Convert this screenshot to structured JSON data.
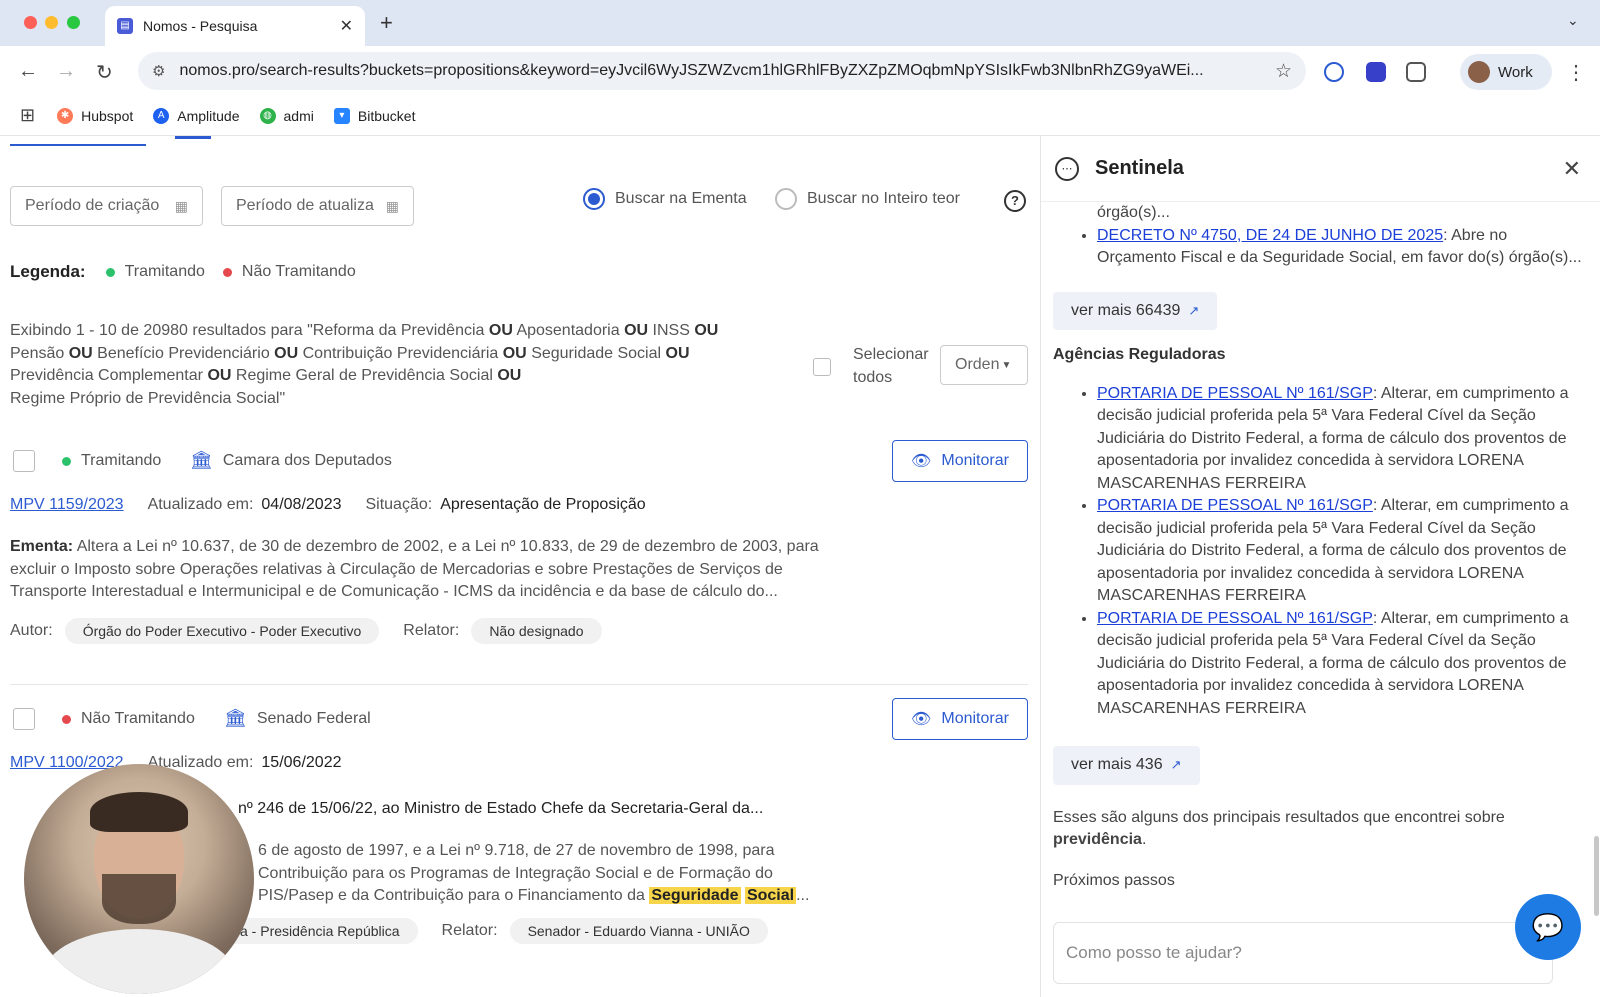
{
  "browser": {
    "tab_title": "Nomos - Pesquisa",
    "url": "nomos.pro/search-results?buckets=propositions&keyword=eyJvcil6WyJSZWZvcm1hlGRhlFByZXZpZMOqbmNpYSIsIkFwb3NlbnRhZG9yaWEi...",
    "profile_label": "Work",
    "bookmarks": [
      "Hubspot",
      "Amplitude",
      "admi",
      "Bitbucket"
    ]
  },
  "filters": {
    "created_placeholder": "Período de criação",
    "updated_placeholder": "Período de atualiza",
    "radio_ementa": "Buscar na Ementa",
    "radio_inteiro": "Buscar no Inteiro teor"
  },
  "legend": {
    "title": "Legenda:",
    "tramitando": "Tramitando",
    "nao_tramitando": "Não Tramitando"
  },
  "results": {
    "line1_pre": "Exibindo 1 - 10 de 20980 resultados para  \"Reforma da Previdência",
    "or": "OU",
    "t_aposentadoria": "Aposentadoria",
    "t_inss": "INSS",
    "t_pensao": "Pensão",
    "t_beneficio": "Benefício Previdenciário",
    "t_contribuicao": "Contribuição Previdenciária",
    "t_seguridade": "Seguridade Social",
    "t_complementar": "Previdência Complementar",
    "t_regime_geral": "Regime Geral de Previdência Social",
    "t_regime_proprio": "Regime Próprio de Previdência Social\"",
    "select_all": "Selecionar todos",
    "order": "Orden"
  },
  "cards": [
    {
      "status": "Tramitando",
      "house": "Camara dos Deputados",
      "monitor": "Monitorar",
      "id": "MPV 1159/2023",
      "updated_label": "Atualizado em:",
      "updated": "04/08/2023",
      "situation_label": "Situação:",
      "situation": "Apresentação de Proposição",
      "ementa_label": "Ementa:",
      "ementa": "Altera a Lei nº 10.637, de 30 de dezembro de 2002, e a Lei nº 10.833, de 29 de dezembro de 2003, para excluir o Imposto sobre Operações relativas à Circulação de Mercadorias e sobre Prestações de Serviços de Transporte Interestadual e Intermunicipal e de Comunicação - ICMS da incidência e da base de cálculo do...",
      "autor_label": "Autor:",
      "autor": "Órgão do Poder Executivo - Poder Executivo",
      "relator_label": "Relator:",
      "relator": "Não designado"
    },
    {
      "status": "Não Tramitando",
      "house": "Senado Federal",
      "monitor": "Monitorar",
      "id": "MPV 1100/2022",
      "updated_label": "Atualizado em:",
      "updated": "15/06/2022",
      "situation_partial": "nº 246 de 15/06/22, ao Ministro de Estado Chefe da Secretaria-Geral da...",
      "ementa_l1": "6 de agosto de 1997, e a Lei nº 9.718, de 27 de novembro de 1998, para",
      "ementa_l2": "Contribuição para os Programas de Integração Social e de Formação do",
      "ementa_l3": "PIS/Pasep e da Contribuição para o Financiamento da",
      "hl1": "Seguridade",
      "hl2": "Social",
      "ellipsis": "...",
      "autor_partial": "a - Presidência República",
      "relator_label": "Relator:",
      "relator": "Senador - Eduardo Vianna - UNIÃO"
    }
  ],
  "panel": {
    "title": "Sentinela",
    "top_fragment": "órgão(s)...",
    "decreto_link": "DECRETO Nº 4750, DE 24 DE JUNHO DE 2025",
    "decreto_text": ": Abre no Orçamento Fiscal e da Seguridade Social, em favor do(s) órgão(s)...",
    "ver_mais_1": "ver mais 66439",
    "agencias_title": "Agências Reguladoras",
    "portaria_link": "PORTARIA DE PESSOAL Nº 161/SGP",
    "portaria_text": ": Alterar, em cumprimento a decisão judicial proferida pela 5ª Vara Federal Cível da Seção Judiciária do Distrito Federal, a forma de cálculo dos proventos de aposentadoria por invalidez concedida à servidora LORENA MASCARENHAS FERREIRA",
    "ver_mais_2": "ver mais 436",
    "summary_pre": "Esses são alguns dos principais resultados que encontrei sobre",
    "summary_bold": "previdência",
    "summary_post": ".",
    "next_steps": "Próximos passos",
    "chat_placeholder": "Como posso te ajudar?"
  }
}
